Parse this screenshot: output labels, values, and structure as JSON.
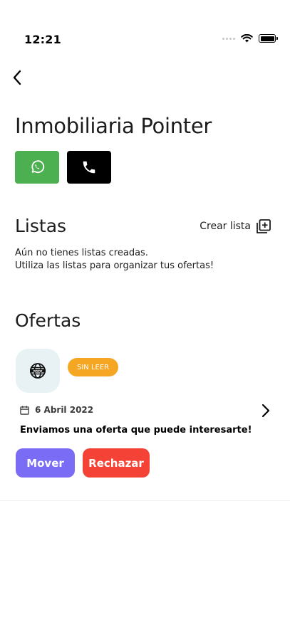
{
  "status_bar": {
    "time": "12:21"
  },
  "agency": {
    "name": "Inmobiliaria Pointer"
  },
  "contact": {
    "whatsapp_icon": "whatsapp-icon",
    "phone_icon": "phone-icon",
    "whatsapp_color": "#4caf50",
    "phone_color": "#000000"
  },
  "lists": {
    "title": "Listas",
    "create_label": "Crear lista",
    "empty_line1": "Aún no tienes listas creadas.",
    "empty_line2": "Utiliza las listas para organizar tus ofertas!"
  },
  "offers": {
    "title": "Ofertas",
    "items": [
      {
        "badge": "SIN LEER",
        "date": "6 Abril 2022",
        "message": "Enviamos una oferta que puede interesarte!",
        "move_label": "Mover",
        "reject_label": "Rechazar",
        "logo_icon": "globe-www-icon",
        "badge_color": "#f5a623",
        "move_color": "#7b6cf6",
        "reject_color": "#f44336"
      }
    ]
  }
}
